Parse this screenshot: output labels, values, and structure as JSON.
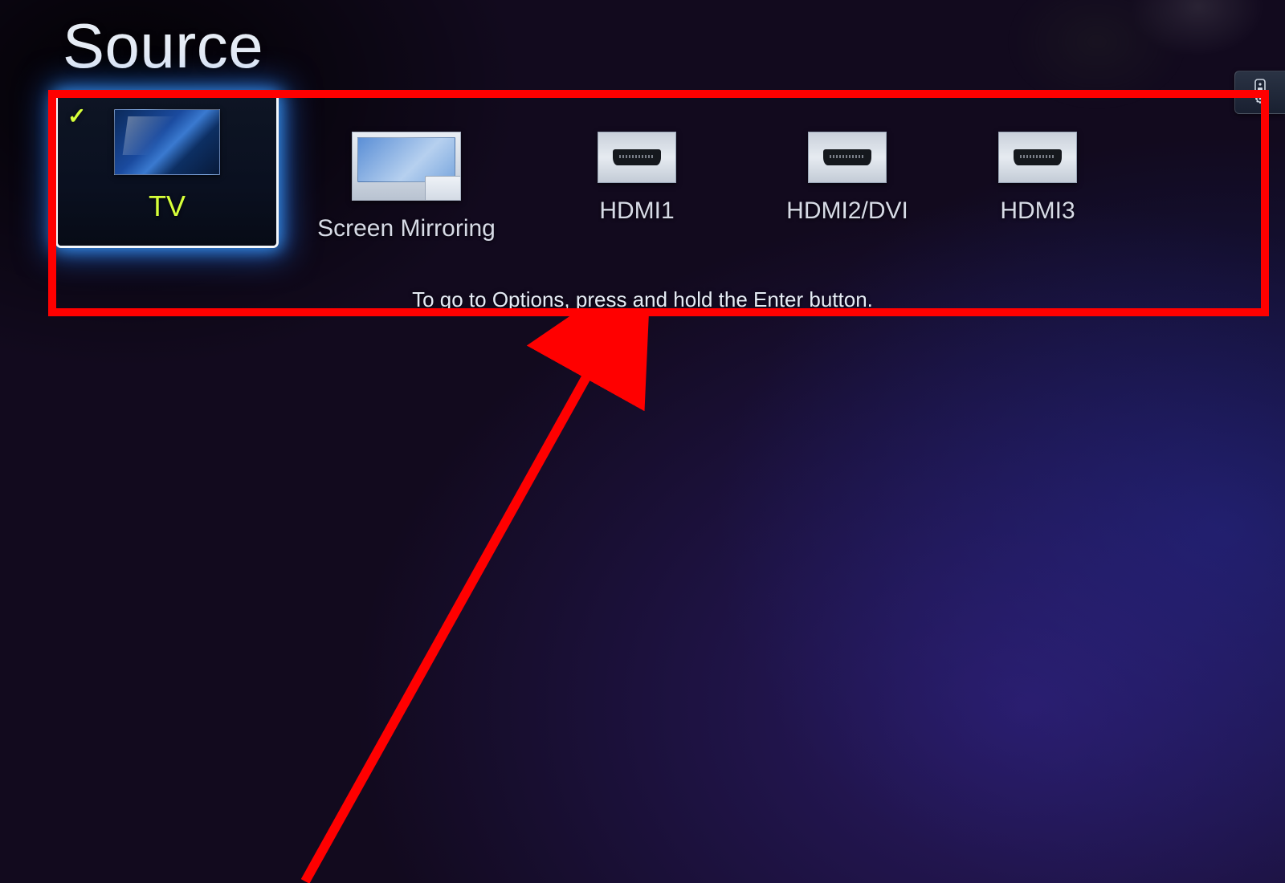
{
  "header": {
    "title": "Source"
  },
  "settings_button": {
    "name": "remote-settings-icon"
  },
  "sources": [
    {
      "id": "tv",
      "label": "TV",
      "icon": "tv-screen-icon",
      "selected": true,
      "active": true
    },
    {
      "id": "mirror",
      "label": "Screen Mirroring",
      "icon": "screen-mirroring-icon",
      "selected": false,
      "active": false
    },
    {
      "id": "hdmi1",
      "label": "HDMI1",
      "icon": "hdmi-port-icon",
      "selected": false,
      "active": false
    },
    {
      "id": "hdmi2",
      "label": "HDMI2/DVI",
      "icon": "hdmi-port-icon",
      "selected": false,
      "active": false
    },
    {
      "id": "hdmi3",
      "label": "HDMI3",
      "icon": "hdmi-port-icon",
      "selected": false,
      "active": false
    }
  ],
  "hint": "To go to Options, press and hold the Enter button.",
  "annotation": {
    "box_color": "#ff0000",
    "arrow_color": "#ff0000"
  }
}
